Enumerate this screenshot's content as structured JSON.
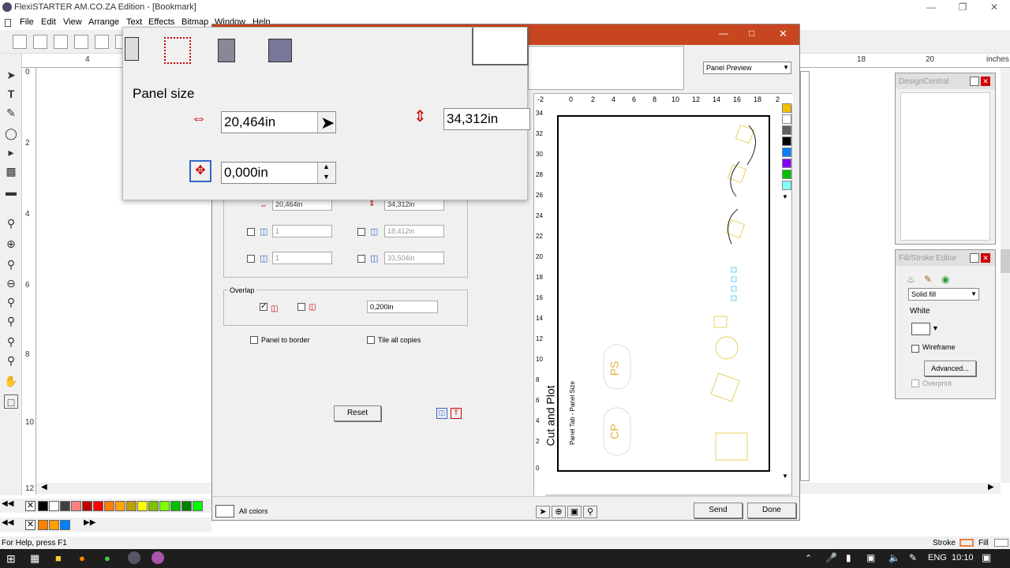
{
  "app": {
    "title": "FlexiSTARTER AM.CO.ZA Edition - [Bookmark]",
    "menu": [
      "File",
      "Edit",
      "View",
      "Arrange",
      "Text",
      "Effects",
      "Bitmap",
      "Window",
      "Help"
    ]
  },
  "ruler": {
    "h_labels": [
      "4",
      "18",
      "20",
      "inches"
    ],
    "v_labels": [
      "0",
      "2",
      "4",
      "6",
      "8",
      "10",
      "12"
    ]
  },
  "zoom_panel": {
    "heading": "Panel size",
    "width_value": "20,464in",
    "height_value": "34,312in",
    "offset_value": "0,000in"
  },
  "dialog": {
    "small_width": "20,464in",
    "small_height": "34,312in",
    "cols_value": "1",
    "rows_value": "1",
    "col_size": "18,412in",
    "row_size": "33,504in",
    "overlap_label": "Overlap",
    "overlap_value": "0,200in",
    "panel_to_border": "Panel to border",
    "tile_all_copies": "Tile all copies",
    "reset_label": "Reset",
    "preview_select": "Panel Preview",
    "all_colors": "All colors",
    "send_label": "Send",
    "done_label": "Done",
    "preview_h_ticks": [
      "-2",
      "0",
      "2",
      "4",
      "6",
      "8",
      "10",
      "12",
      "14",
      "16",
      "18",
      "2"
    ],
    "preview_v_ticks": [
      "34",
      "32",
      "30",
      "28",
      "26",
      "24",
      "22",
      "20",
      "18",
      "16",
      "14",
      "12",
      "10",
      "8",
      "6",
      "4",
      "2",
      "0"
    ],
    "preview_text_main": "Cut and Plot",
    "preview_text_sub": "Panel Tab - Panel Size",
    "preview_logo_ps": "PS",
    "preview_logo_cp": "CP",
    "colors": [
      "#f0c000",
      "#ffffff",
      "#606060",
      "#000000",
      "#0080ff",
      "#8000ff",
      "#00c000",
      "#80ffff"
    ]
  },
  "design_central": {
    "title": "DesignCentral"
  },
  "fill_stroke": {
    "title": "Fill/Stroke Editor",
    "fill_type": "Solid fill",
    "color_name": "White",
    "wireframe": "Wireframe",
    "advanced": "Advanced...",
    "overprint": "Overprint"
  },
  "palette": {
    "row1": [
      "#000000",
      "#ffffff",
      "#404040",
      "#808080",
      "#c0c0c0",
      "#ff8080",
      "#c00000",
      "#ff0000",
      "#ff8000",
      "#ffa500",
      "#c0a000",
      "#ffff00",
      "#80c000",
      "#80ff00",
      "#00c000",
      "#008000",
      "#00ff00"
    ],
    "row2": [
      "#ff8000",
      "#ffa000",
      "#0080ff"
    ]
  },
  "status": {
    "help": "For Help, press F1",
    "stroke": "Stroke",
    "fill": "Fill"
  },
  "taskbar": {
    "lang": "ENG",
    "time": "10:10"
  }
}
